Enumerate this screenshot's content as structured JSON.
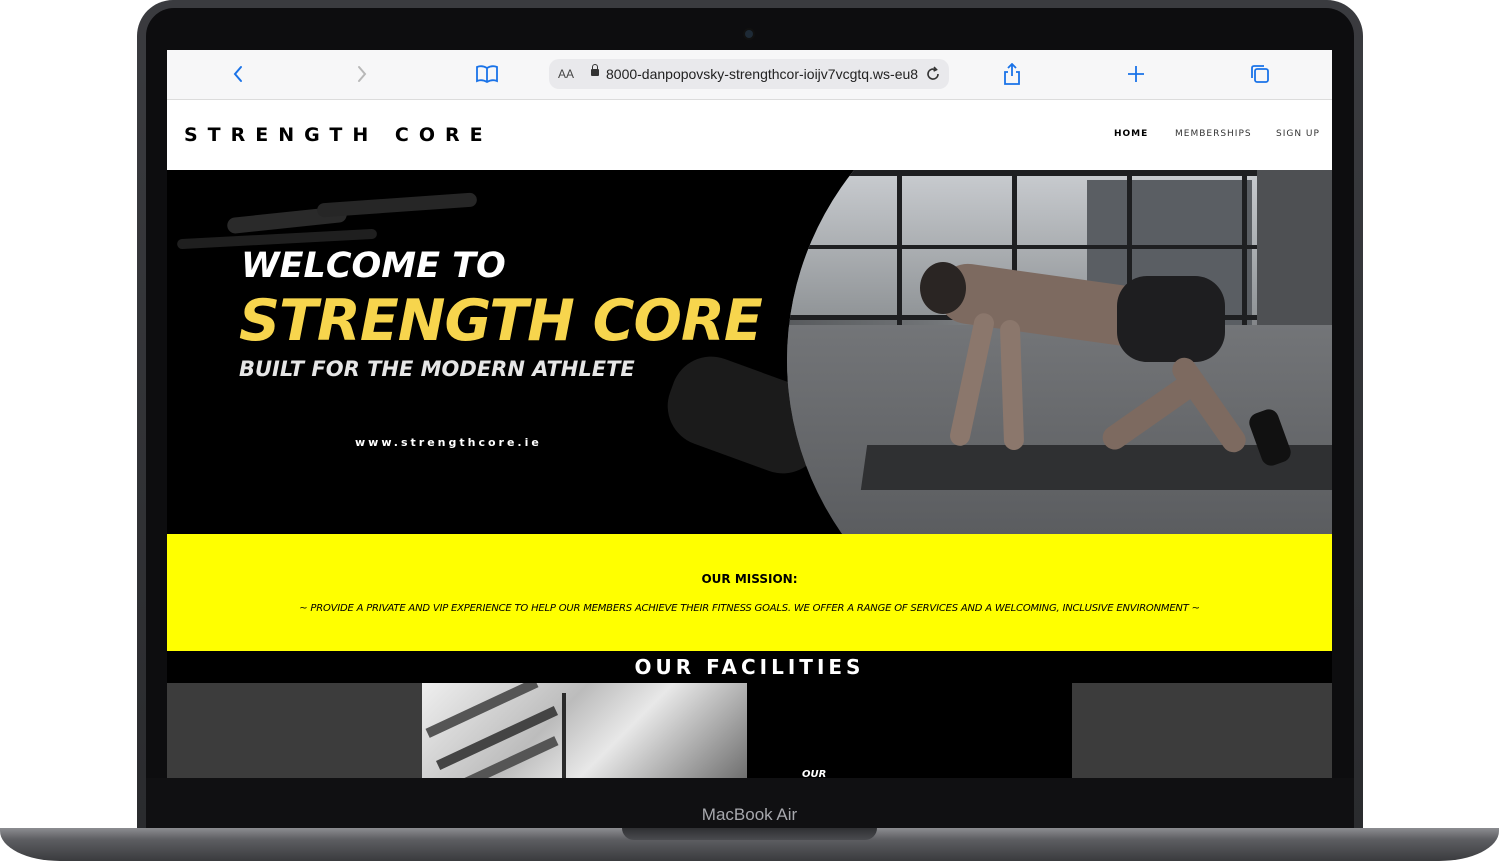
{
  "device": {
    "label": "MacBook Air"
  },
  "browser": {
    "url": "8000-danpopovsky-strengthcor-ioijv7vcgtq.ws-eu8",
    "text_size_label": "AA",
    "icons": [
      "chevron-left-icon",
      "chevron-right-icon",
      "book-icon",
      "lock-icon",
      "reload-icon",
      "share-icon",
      "plus-icon",
      "tabs-icon"
    ],
    "accent": "#1a73e8"
  },
  "site": {
    "logo": "STRENGTH CORE",
    "nav": [
      "HOME",
      "MEMBERSHIPS",
      "SIGN UP"
    ],
    "active_nav": "HOME"
  },
  "hero": {
    "welcome": "WELCOME TO",
    "name": "STRENGTH CORE",
    "tagline": "BUILT FOR THE MODERN ATHLETE",
    "website": "www.strengthcore.ie",
    "accent": "#f7d54d"
  },
  "mission": {
    "title": "OUR MISSION:",
    "text": "~ PROVIDE A PRIVATE AND VIP EXPERIENCE TO HELP OUR MEMBERS ACHIEVE THEIR FITNESS GOALS. WE OFFER A RANGE OF SERVICES AND A WELCOMING, INCLUSIVE ENVIRONMENT ~",
    "background": "#ffff00"
  },
  "facilities": {
    "title": "OUR FACILITIES",
    "card_label": "OUR"
  }
}
